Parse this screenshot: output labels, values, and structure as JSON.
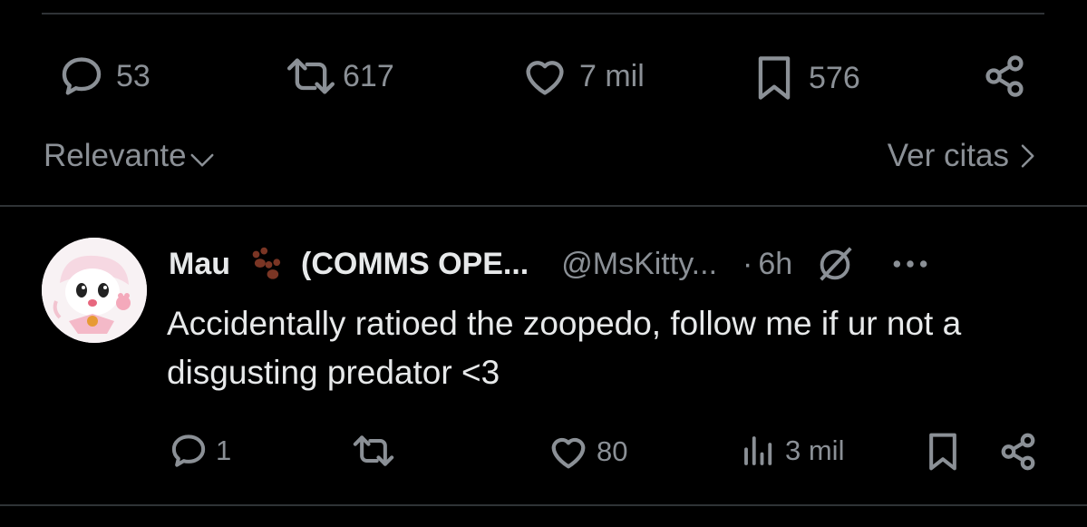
{
  "main_post_actions": {
    "replies": "53",
    "reposts": "617",
    "likes": "7 mil",
    "bookmarks": "576"
  },
  "reply_controls": {
    "sort_label": "Relevante",
    "quotes_label": "Ver citas"
  },
  "reply": {
    "display_name_prefix": "Mau",
    "display_name_suffix": "(COMMS OPE...",
    "handle": "@MsKitty...",
    "separator": "·",
    "time": "6h",
    "text": "Accidentally ratioed the zoopedo, follow me if ur not a disgusting predator <3",
    "actions": {
      "replies": "1",
      "likes": "80",
      "views": "3 mil"
    }
  },
  "colors": {
    "background": "#000000",
    "text_primary": "#e7e9ea",
    "text_secondary": "#8b9096",
    "divider": "#2f3336",
    "paw": "#7a3524"
  }
}
